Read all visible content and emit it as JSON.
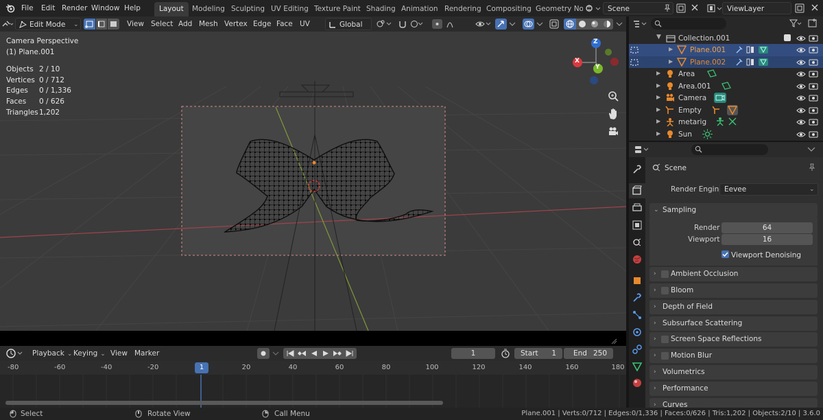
{
  "topbar": {
    "menus": [
      "File",
      "Edit",
      "Render",
      "Window",
      "Help"
    ],
    "workspaces": [
      "Layout",
      "Modeling",
      "Sculpting",
      "UV Editing",
      "Texture Paint",
      "Shading",
      "Animation",
      "Rendering",
      "Compositing",
      "Geometry Noc"
    ],
    "scene": "Scene",
    "view_layer": "ViewLayer"
  },
  "viewport_header": {
    "mode": "Edit Mode",
    "menus": [
      "View",
      "Select",
      "Add",
      "Mesh",
      "Vertex",
      "Edge",
      "Face",
      "UV"
    ],
    "transform": "Global"
  },
  "overlay": {
    "title": "Camera Perspective",
    "subtitle": "(1) Plane.001",
    "stats": [
      {
        "label": "Objects",
        "value": "2 / 10"
      },
      {
        "label": "Vertices",
        "value": "0 / 712"
      },
      {
        "label": "Edges",
        "value": "0 / 1,336"
      },
      {
        "label": "Faces",
        "value": "0 / 626"
      },
      {
        "label": "Triangles",
        "value": "1,202"
      }
    ]
  },
  "gizmo": {
    "x": "X",
    "y": "Y",
    "z": "Z"
  },
  "outliner": {
    "rows": [
      "Collection.001",
      "Plane.001",
      "Plane.002",
      "Area",
      "Area.001",
      "Camera",
      "Empty",
      "metarig",
      "Sun"
    ]
  },
  "properties": {
    "scene_label": "Scene",
    "render_engine_label": "Render Engine",
    "render_engine": "Eevee",
    "sampling": "Sampling",
    "render_label": "Render",
    "render_value": "64",
    "viewport_label": "Viewport",
    "viewport_value": "16",
    "denoise": "Viewport Denoising",
    "panels": [
      "Ambient Occlusion",
      "Bloom",
      "Depth of Field",
      "Subsurface Scattering",
      "Screen Space Reflections",
      "Motion Blur",
      "Volumetrics",
      "Performance",
      "Curves"
    ]
  },
  "timeline": {
    "menus": [
      "Playback",
      "Keying",
      "View",
      "Marker"
    ],
    "current_frame": "1",
    "start_label": "Start",
    "start": "1",
    "end_label": "End",
    "end": "250",
    "ticks": [
      "-80",
      "-60",
      "-40",
      "-20",
      "1",
      "20",
      "40",
      "60",
      "80",
      "100",
      "120",
      "140",
      "160",
      "180"
    ]
  },
  "status": {
    "select": "Select",
    "rotate": "Rotate View",
    "call_menu": "Call Menu",
    "info": "Plane.001 | Verts:0/712 | Edges:0/1,336 | Faces:0/626 | Tris:1,202 | Objects:2/10 | 3.6.0"
  },
  "colors": {
    "accent": "#4772b3",
    "selected_row": "#334d80",
    "orange": "#e8892d",
    "red_axis": "#c0404a",
    "green_axis": "#86a63a"
  }
}
